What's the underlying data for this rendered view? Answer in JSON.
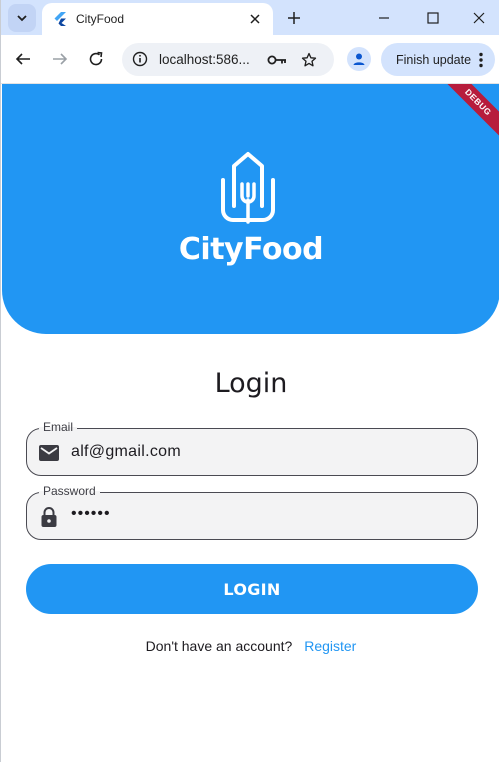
{
  "browser": {
    "tab_title": "CityFood",
    "url": "localhost:586...",
    "finish_update_label": "Finish update"
  },
  "app": {
    "brand_name": "CityFood",
    "debug_banner": "DEBUG",
    "login_title": "Login",
    "email": {
      "label": "Email",
      "value": "alf@gmail.com"
    },
    "password": {
      "label": "Password",
      "value": "••••••"
    },
    "login_button": "LOGIN",
    "register_prompt": "Don't have an account?",
    "register_link": "Register"
  },
  "colors": {
    "primary": "#2196f3",
    "debug_banner": "#b71c3c",
    "tab_strip": "#d3e3fd"
  }
}
